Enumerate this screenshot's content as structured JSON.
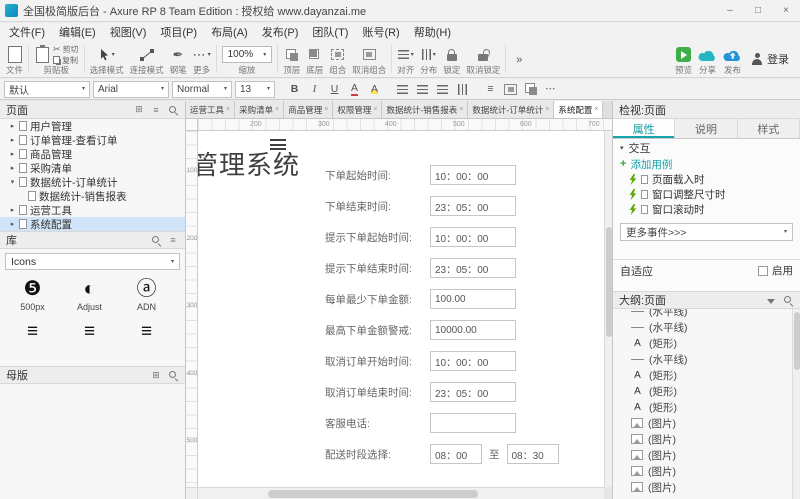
{
  "icons": {
    "caret_down": "▾",
    "arrow_collapsed": "▸",
    "arrow_expanded": "▾",
    "close": "×",
    "overflow": "»",
    "more": "⋯",
    "menu": "≡",
    "plus": "+",
    "add_box": "⊞",
    "minimize": "–",
    "maximize": "□",
    "scissors": "✂",
    "pen": "✒",
    "adjust_glyph": "◐",
    "adn_glyph": "ⓐ",
    "px500_glyph": "❺",
    "bold": "B",
    "italic": "I",
    "underline": "U",
    "color_letter": "A",
    "highlight_letter": "A"
  },
  "title_bar": {
    "title": "全国极简版后台 - Axure RP 8 Team Edition : 授权给 www.dayanzai.me"
  },
  "menu": {
    "items": [
      "文件(F)",
      "编辑(E)",
      "视图(V)",
      "项目(P)",
      "布局(A)",
      "发布(P)",
      "团队(T)",
      "账号(R)",
      "帮助(H)"
    ]
  },
  "toolbar": {
    "file": "文件",
    "clipboard": "剪贴板",
    "cut": "剪切",
    "copy": "复制",
    "select_mode": "选择模式",
    "connect_mode": "连接模式",
    "pen": "钢笔",
    "more": "更多",
    "zoom_value": "100%",
    "zoom": "缩放",
    "top_layer": "顶层",
    "bottom_layer": "底层",
    "group": "组合",
    "ungroup": "取消组合",
    "align": "对齐",
    "distribute": "分布",
    "lock": "锁定",
    "unlock": "取消锁定",
    "preview": "预览",
    "share": "分享",
    "publish": "发布",
    "login": "登录"
  },
  "format_bar": {
    "preset": "默认",
    "font": "Arial",
    "weight": "Normal",
    "size": "13"
  },
  "pages": {
    "title": "页面",
    "items": [
      {
        "label": "用户管理"
      },
      {
        "label": "订单管理-查看订单"
      },
      {
        "label": "商品管理"
      },
      {
        "label": "采购清单"
      },
      {
        "label": "数据统计-订单统计"
      },
      {
        "label": "数据统计-销售报表"
      },
      {
        "label": "运营工具"
      },
      {
        "label": "系统配置"
      }
    ]
  },
  "library": {
    "title": "库",
    "category": "Icons",
    "items": [
      {
        "label": "500px"
      },
      {
        "label": "Adjust"
      },
      {
        "label": "ADN"
      }
    ]
  },
  "masters": {
    "title": "母版"
  },
  "doc_tabs": {
    "items": [
      "运营工具",
      "采购清单",
      "商品管理",
      "权限管理",
      "数据统计-销售报表",
      "数据统计-订单统计",
      "系统配置"
    ]
  },
  "ruler": {
    "h": [
      "200",
      "300",
      "400",
      "500",
      "600",
      "700"
    ],
    "v": [
      "100",
      "200",
      "300",
      "400",
      "500"
    ]
  },
  "canvas": {
    "page_title": "管理系统",
    "form": [
      {
        "label": "下单起始时间:",
        "value": "10：00：00"
      },
      {
        "label": "下单结束时间:",
        "value": "23：05：00"
      },
      {
        "label": "提示下单起始时间:",
        "value": "10：00：00"
      },
      {
        "label": "提示下单结束时间:",
        "value": "23：05：00"
      },
      {
        "label": "每单最少下单金额:",
        "value": "100.00"
      },
      {
        "label": "最高下单金额警戒:",
        "value": "10000.00"
      },
      {
        "label": "取消订单开始时间:",
        "value": "10：00：00"
      },
      {
        "label": "取消订单结束时间:",
        "value": "23：05：00"
      },
      {
        "label": "客服电话:",
        "value": ""
      },
      {
        "label": "配送时段选择:",
        "value": "08：00",
        "to": "至",
        "value2": "08：30"
      }
    ]
  },
  "inspector": {
    "title": "检视:页面",
    "tabs": [
      "属性",
      "说明",
      "样式"
    ],
    "interaction": "交互",
    "add_case": "添加用例",
    "events": [
      "页面载入时",
      "窗口调整尺寸时",
      "窗口滚动时"
    ],
    "more_events": "更多事件>>>",
    "adaptive": "自适应",
    "enable": "启用"
  },
  "outline": {
    "title": "大纲:页面",
    "items": [
      {
        "kind": "line",
        "label": "(水平线)"
      },
      {
        "kind": "line",
        "label": "(水平线)"
      },
      {
        "kind": "rect",
        "label": "(矩形)"
      },
      {
        "kind": "line",
        "label": "(水平线)"
      },
      {
        "kind": "rect",
        "label": "(矩形)"
      },
      {
        "kind": "rect",
        "label": "(矩形)"
      },
      {
        "kind": "rect",
        "label": "(矩形)"
      },
      {
        "kind": "image",
        "label": "(图片)"
      },
      {
        "kind": "image",
        "label": "(图片)"
      },
      {
        "kind": "image",
        "label": "(图片)"
      },
      {
        "kind": "image",
        "label": "(图片)"
      },
      {
        "kind": "image",
        "label": "(图片)"
      }
    ]
  }
}
